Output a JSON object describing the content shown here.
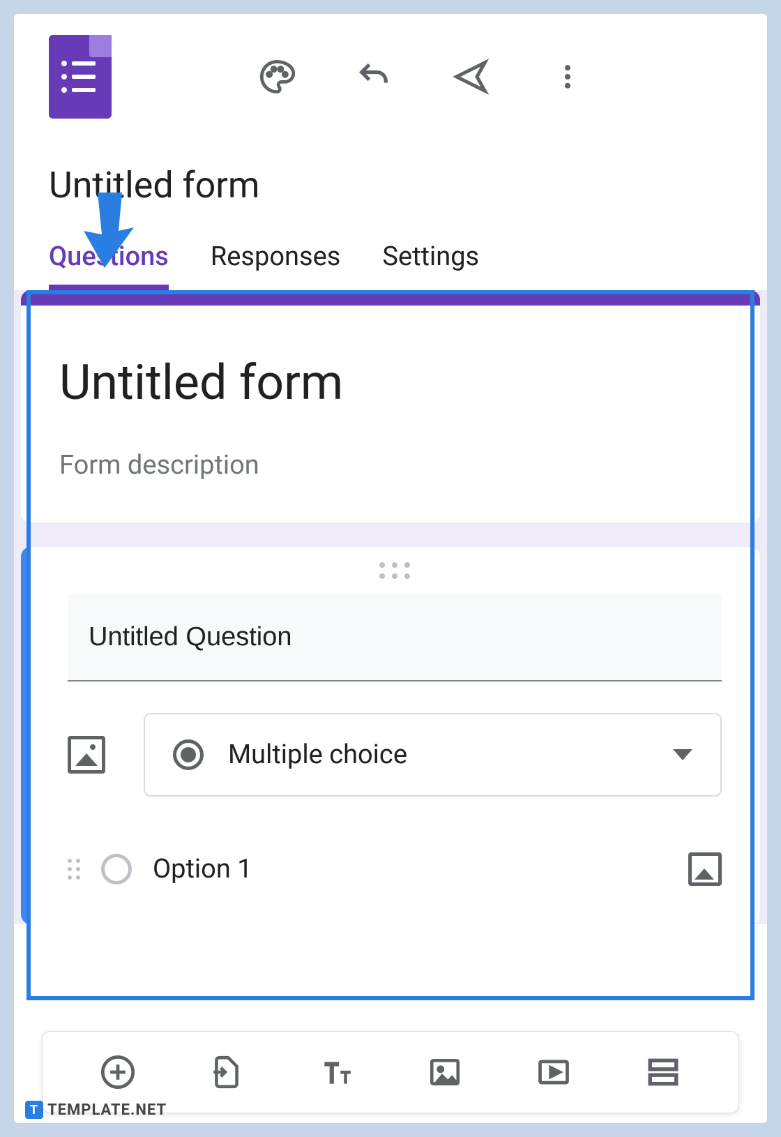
{
  "header": {
    "doc_title": "Untitled form"
  },
  "tabs": {
    "questions": "Questions",
    "responses": "Responses",
    "settings": "Settings",
    "active": "questions"
  },
  "form": {
    "title": "Untitled form",
    "description_placeholder": "Form description"
  },
  "question": {
    "title": "Untitled Question",
    "type_label": "Multiple choice",
    "options": [
      "Option 1"
    ]
  },
  "bottom_toolbar": {
    "items": [
      "add-question",
      "import-questions",
      "add-title",
      "add-image",
      "add-video",
      "add-section"
    ]
  },
  "watermark": {
    "badge": "T",
    "text": "TEMPLATE.NET"
  }
}
